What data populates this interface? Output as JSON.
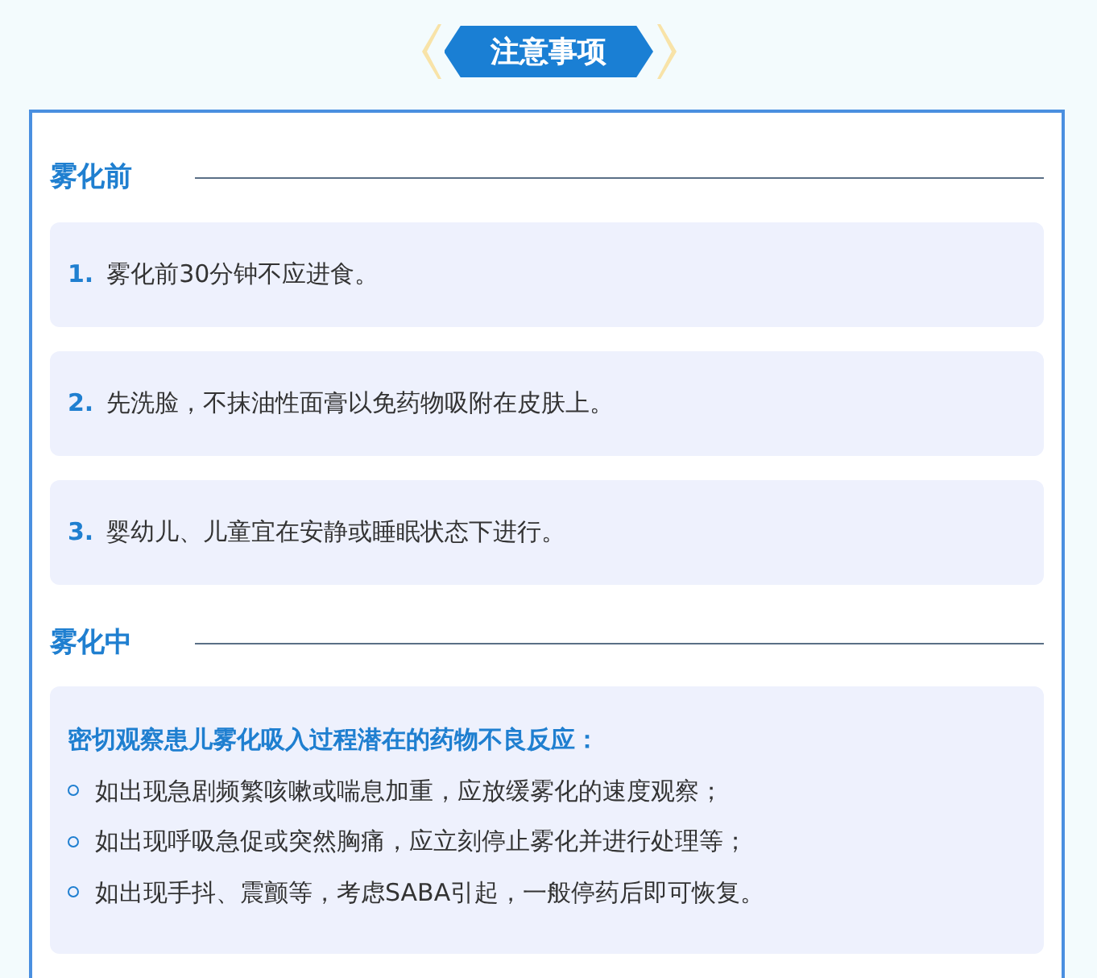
{
  "banner": {
    "title": "注意事项"
  },
  "sections": [
    {
      "heading": "雾化前",
      "kind": "numbered",
      "items": [
        {
          "number": "1.",
          "text": "雾化前30分钟不应进食。"
        },
        {
          "number": "2.",
          "text": "先洗脸，不抹油性面膏以免药物吸附在皮肤上。"
        },
        {
          "number": "3.",
          "text": "婴幼儿、儿童宜在安静或睡眠状态下进行。"
        }
      ]
    },
    {
      "heading": "雾化中",
      "kind": "note",
      "lead": "密切观察患儿雾化吸入过程潜在的药物不良反应：",
      "bullets": [
        "如出现急剧频繁咳嗽或喘息加重，应放缓雾化的速度观察；",
        "如出现呼吸急促或突然胸痛，应立刻停止雾化并进行处理等；",
        "如出现手抖、震颤等，考虑SABA引起，一般停药后即可恢复。"
      ]
    }
  ]
}
